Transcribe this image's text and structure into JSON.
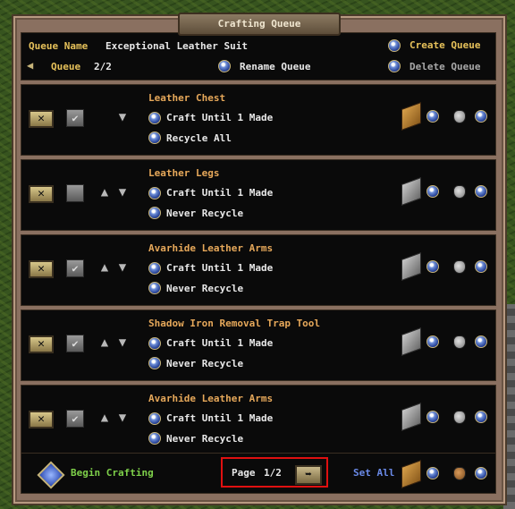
{
  "window": {
    "title": "Crafting Queue"
  },
  "header": {
    "queue_name_label": "Queue Name",
    "queue_name_value": "Exceptional Leather Suit",
    "queue_label": "Queue",
    "queue_value": "2/2",
    "create_queue": "Create Queue",
    "rename_queue": "Rename Queue",
    "delete_queue": "Delete Queue"
  },
  "rows": [
    {
      "title": "Leather Chest",
      "craft": "Craft Until 1 Made",
      "recycle": "Recycle All",
      "check": "✔",
      "box": "wood"
    },
    {
      "title": "Leather Legs",
      "craft": "Craft Until 1 Made",
      "recycle": "Never Recycle",
      "check": "",
      "box": "iron"
    },
    {
      "title": "Avarhide Leather Arms",
      "craft": "Craft Until 1 Made",
      "recycle": "Never Recycle",
      "check": "✔",
      "box": "iron"
    },
    {
      "title": "Shadow Iron Removal Trap Tool",
      "craft": "Craft Until 1 Made",
      "recycle": "Never Recycle",
      "check": "✔",
      "box": "iron"
    },
    {
      "title": "Avarhide Leather Arms",
      "craft": "Craft Until 1 Made",
      "recycle": "Never Recycle",
      "check": "✔",
      "box": "iron"
    }
  ],
  "footer": {
    "begin_crafting": "Begin Crafting",
    "page_label": "Page",
    "page_value": "1/2",
    "set_all": "Set All"
  },
  "colors": {
    "accent_gold": "#e6c15a",
    "item_orange": "#e6a85a",
    "begin_green": "#7ed04a",
    "set_all_blue": "#6a8ae8",
    "highlight_red": "#e01010"
  }
}
